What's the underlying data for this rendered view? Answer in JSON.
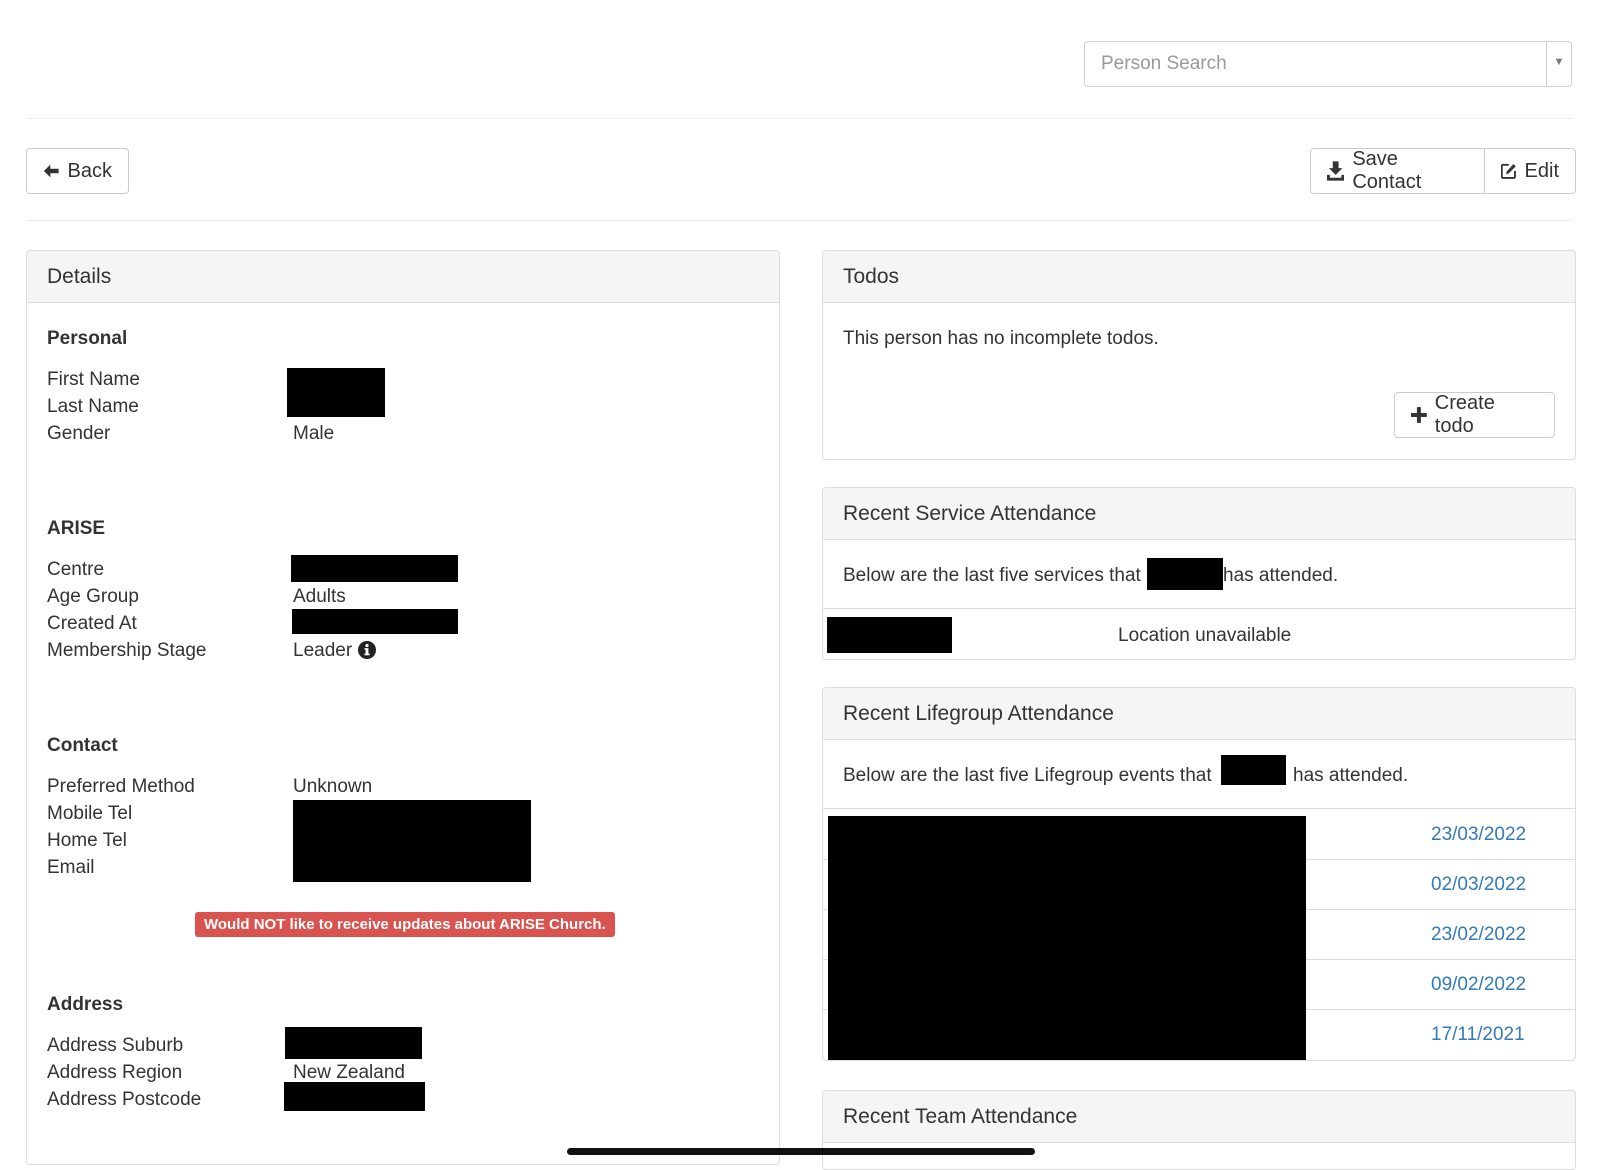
{
  "search": {
    "placeholder": "Person Search"
  },
  "toolbar": {
    "back_label": "Back",
    "save_contact_label": "Save Contact",
    "edit_label": "Edit"
  },
  "details": {
    "title": "Details",
    "personal": {
      "heading": "Personal",
      "first_name_label": "First Name",
      "last_name_label": "Last Name",
      "gender_label": "Gender",
      "gender_value": "Male"
    },
    "arise": {
      "heading": "ARISE",
      "centre_label": "Centre",
      "age_group_label": "Age Group",
      "age_group_value": "Adults",
      "created_at_label": "Created At",
      "membership_stage_label": "Membership Stage",
      "membership_stage_value": "Leader"
    },
    "contact": {
      "heading": "Contact",
      "preferred_method_label": "Preferred Method",
      "preferred_method_value": "Unknown",
      "mobile_label": "Mobile Tel",
      "home_label": "Home Tel",
      "email_label": "Email",
      "updates_badge": "Would NOT like to receive updates about ARISE Church."
    },
    "address": {
      "heading": "Address",
      "suburb_label": "Address Suburb",
      "region_label": "Address Region",
      "region_value": "New Zealand",
      "postcode_label": "Address Postcode"
    }
  },
  "todos": {
    "title": "Todos",
    "empty_text": "This person has no incomplete todos.",
    "create_label": "Create todo"
  },
  "service_attendance": {
    "title": "Recent Service Attendance",
    "intro_before": "Below are the last five services that",
    "intro_after": "has attended.",
    "location": "Location unavailable"
  },
  "lifegroup_attendance": {
    "title": "Recent Lifegroup Attendance",
    "intro_before": "Below are the last five Lifegroup events that",
    "intro_after": "has attended.",
    "dates": [
      "23/03/2022",
      "02/03/2022",
      "23/02/2022",
      "09/02/2022",
      "17/11/2021"
    ]
  },
  "team_attendance": {
    "title": "Recent Team Attendance"
  },
  "colors": {
    "link": "#337ab7",
    "danger": "#d9534f",
    "panel_heading_bg": "#f5f5f5",
    "border": "#dddddd"
  },
  "icons": {
    "back": "arrow-left-icon",
    "save": "download-icon",
    "edit": "edit-icon",
    "create": "plus-icon",
    "info": "info-circle-icon",
    "search_dropdown": "caret-down-icon"
  }
}
